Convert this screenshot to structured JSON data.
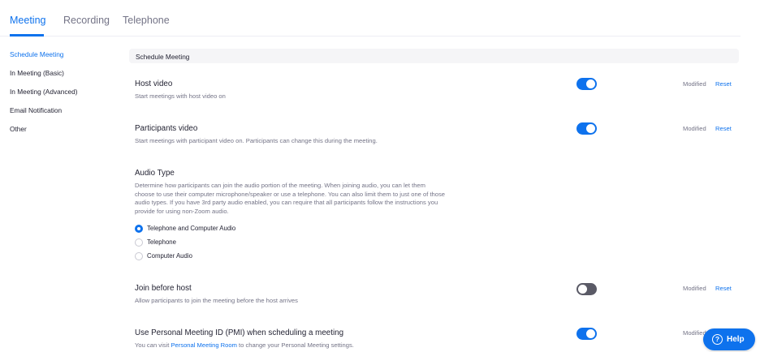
{
  "tabs": [
    {
      "label": "Meeting"
    },
    {
      "label": "Recording"
    },
    {
      "label": "Telephone"
    }
  ],
  "sidebar": {
    "items": [
      {
        "label": "Schedule Meeting"
      },
      {
        "label": "In Meeting (Basic)"
      },
      {
        "label": "In Meeting (Advanced)"
      },
      {
        "label": "Email Notification"
      },
      {
        "label": "Other"
      }
    ]
  },
  "section": {
    "title": "Schedule Meeting"
  },
  "settings": {
    "host_video": {
      "title": "Host video",
      "desc": "Start meetings with host video on",
      "enabled": true,
      "modified": "Modified",
      "reset": "Reset"
    },
    "participants_video": {
      "title": "Participants video",
      "desc": "Start meetings with participant video on. Participants can change this during the meeting.",
      "enabled": true,
      "modified": "Modified",
      "reset": "Reset"
    },
    "audio_type": {
      "title": "Audio Type",
      "desc_lines": [
        "Determine how participants can join the audio portion of the meeting. When joining audio, you can let them",
        "choose to use their computer microphone/speaker or use a telephone. You can also limit them to just one of those",
        "audio types. If you have 3rd party audio enabled, you can require that all participants follow the instructions you",
        "provide for using non-Zoom audio."
      ],
      "options": [
        {
          "label": "Telephone and Computer Audio",
          "selected": true
        },
        {
          "label": "Telephone",
          "selected": false
        },
        {
          "label": "Computer Audio",
          "selected": false
        }
      ]
    },
    "join_before_host": {
      "title": "Join before host",
      "desc": "Allow participants to join the meeting before the host arrives",
      "enabled": false,
      "modified": "Modified",
      "reset": "Reset"
    },
    "pmi": {
      "title": "Use Personal Meeting ID (PMI) when scheduling a meeting",
      "desc_prefix": "You can visit ",
      "desc_link": "Personal Meeting Room",
      "desc_suffix": " to change your Personal Meeting settings.",
      "enabled": true,
      "modified": "Modified"
    }
  },
  "help": {
    "icon_glyph": "?",
    "label": "Help"
  },
  "colors": {
    "accent": "#0e72ed",
    "toggle_off": "#5a5a66",
    "muted_text": "#747487"
  }
}
